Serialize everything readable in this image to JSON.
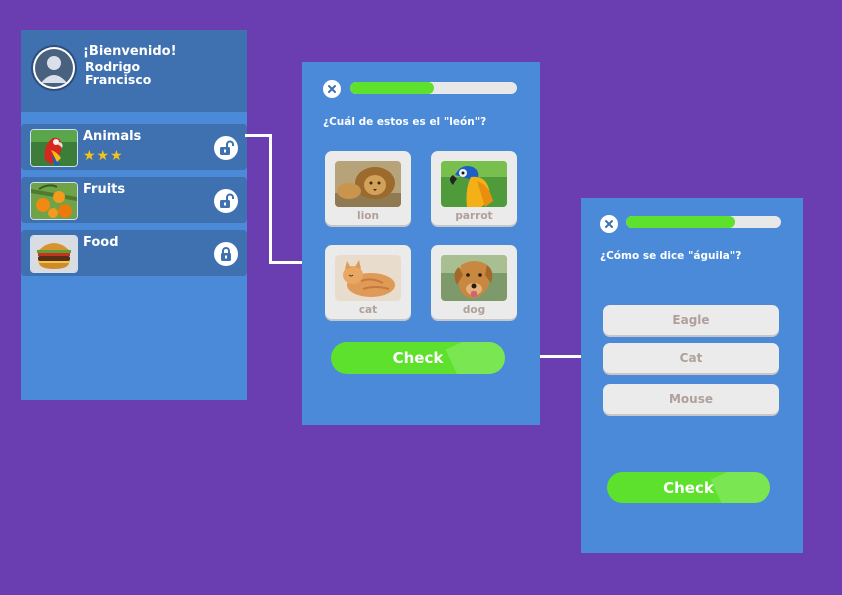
{
  "home": {
    "welcome": "¡Bienvenido!",
    "user_name": "Rodrigo Francisco",
    "categories": [
      {
        "name": "Animals",
        "stars": "★★★",
        "lock": "unlocked"
      },
      {
        "name": "Fruits",
        "stars": "",
        "lock": "unlocked"
      },
      {
        "name": "Food",
        "stars": "",
        "lock": "locked"
      }
    ]
  },
  "quiz1": {
    "progress": 0.5,
    "question": "¿Cuál de estos es el \"león\"?",
    "options": [
      "lion",
      "parrot",
      "cat",
      "dog"
    ],
    "check_label": "Check"
  },
  "quiz2": {
    "progress": 0.7,
    "question": "¿Cómo se dice \"águila\"?",
    "options": [
      "Eagle",
      "Cat",
      "Mouse"
    ],
    "check_label": "Check"
  },
  "colors": {
    "background": "#6a3db0",
    "screen": "#4a8ad9",
    "accent_green": "#5de12c",
    "star": "#f4c21b"
  }
}
